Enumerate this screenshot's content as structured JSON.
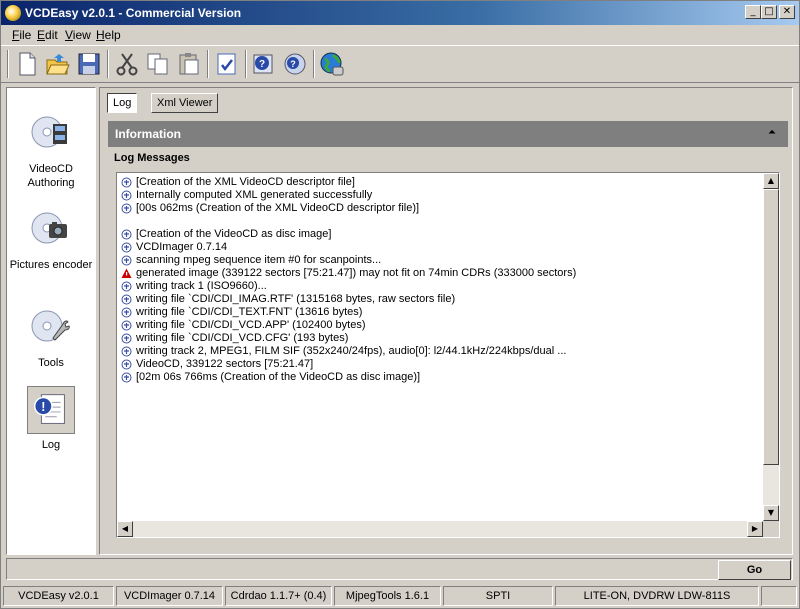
{
  "window": {
    "title": "VCDEasy v2.0.1 - Commercial Version"
  },
  "menu": [
    {
      "key": "F",
      "rest": "ile"
    },
    {
      "key": "E",
      "rest": "dit"
    },
    {
      "key": "V",
      "rest": "iew"
    },
    {
      "key": "H",
      "rest": "elp"
    }
  ],
  "toolbar": {
    "icons": [
      "new-icon",
      "open-icon",
      "save-icon",
      "cut-icon",
      "copy-icon",
      "paste-icon",
      "check-icon",
      "help-icon",
      "about-icon",
      "web-icon"
    ]
  },
  "sidebar": {
    "items": [
      {
        "label": "VideoCD Authoring",
        "icon": "videocd-icon",
        "selected": false
      },
      {
        "label": "Pictures encoder",
        "icon": "pictures-icon",
        "selected": false
      },
      {
        "label": "Tools",
        "icon": "tools-icon",
        "selected": false
      },
      {
        "label": "Log",
        "icon": "log-icon",
        "selected": true
      }
    ]
  },
  "tabs": [
    {
      "label": "Log",
      "active": true
    },
    {
      "label": "Xml Viewer",
      "active": false
    }
  ],
  "info_panel": {
    "title": "Information",
    "collapse_glyph": "⏶"
  },
  "log": {
    "title": "Log Messages",
    "lines": [
      {
        "type": "info",
        "text": "[Creation of the XML VideoCD descriptor file]"
      },
      {
        "type": "info",
        "text": "Internally computed XML generated successfully"
      },
      {
        "type": "info",
        "text": "[00s 062ms (Creation of the XML VideoCD descriptor file)]"
      },
      {
        "type": "blank",
        "text": ""
      },
      {
        "type": "info",
        "text": "[Creation of the VideoCD as disc image]"
      },
      {
        "type": "info",
        "text": "VCDImager 0.7.14"
      },
      {
        "type": "info",
        "text": "scanning mpeg sequence item #0 for scanpoints..."
      },
      {
        "type": "warning",
        "text": "generated image (339122 sectors [75:21.47]) may not fit on 74min CDRs (333000 sectors)"
      },
      {
        "type": "info",
        "text": "writing track 1 (ISO9660)..."
      },
      {
        "type": "info",
        "text": "writing file `CDI/CDI_IMAG.RTF' (1315168 bytes, raw sectors file)"
      },
      {
        "type": "info",
        "text": "writing file `CDI/CDI_TEXT.FNT' (13616 bytes)"
      },
      {
        "type": "info",
        "text": "writing file `CDI/CDI_VCD.APP' (102400 bytes)"
      },
      {
        "type": "info",
        "text": "writing file `CDI/CDI_VCD.CFG' (193 bytes)"
      },
      {
        "type": "info",
        "text": "writing track 2, MPEG1, FILM SIF (352x240/24fps), audio[0]: l2/44.1kHz/224kbps/dual ..."
      },
      {
        "type": "info",
        "text": "VideoCD, 339122 sectors [75:21.47]"
      },
      {
        "type": "info",
        "text": "[02m 06s 766ms (Creation of the VideoCD as disc image)]"
      }
    ]
  },
  "go_button": "Go",
  "status": [
    "VCDEasy v2.0.1",
    "VCDImager 0.7.14",
    "Cdrdao 1.1.7+ (0.4)",
    "MjpegTools 1.6.1",
    "SPTI",
    "LITE-ON, DVDRW LDW-811S"
  ],
  "colors": {
    "titlebar": "#0a246a",
    "face": "#d4d0c8",
    "info_header": "#7f7f7f",
    "warning": "#cc0000",
    "info_icon": "#3a4fa0"
  }
}
